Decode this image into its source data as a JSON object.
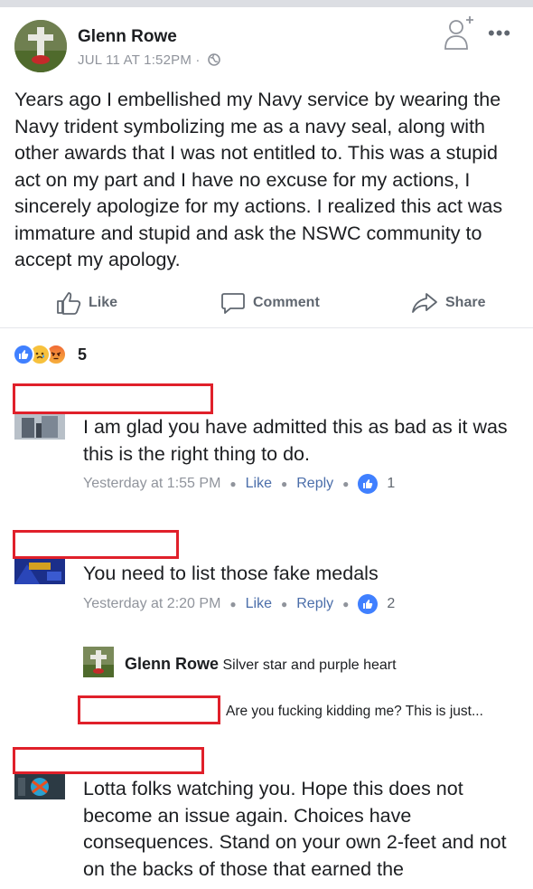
{
  "post": {
    "author": "Glenn Rowe",
    "timestamp": "JUL 11 AT 1:52PM ·",
    "privacy_icon": "globe-icon",
    "text": "Years ago I embellished my Navy service by wearing the Navy trident symbolizing me as a navy seal, along with other awards that I was not entitled to. This was a stupid act on my part and I have no excuse for my actions, I sincerely apologize for my actions. I realized this act was immature and stupid and ask the NSWC community to accept my apology."
  },
  "actions": {
    "like": "Like",
    "comment": "Comment",
    "share": "Share"
  },
  "reactions": {
    "count": "5",
    "types": [
      "like",
      "sad",
      "angry"
    ]
  },
  "comments": [
    {
      "text": "I am glad you have admitted this as bad as it was this is the right thing to do.",
      "time": "Yesterday at 1:55 PM",
      "like": "Like",
      "reply": "Reply",
      "likes": "1"
    },
    {
      "text": "You need to list those fake medals",
      "time": "Yesterday at 2:20 PM",
      "like": "Like",
      "reply": "Reply",
      "likes": "2"
    },
    {
      "text": "Lotta folks watching you.  Hope this does not become an issue again.  Choices have consequences.  Stand on your own 2-feet and not on the backs of those that earned the"
    }
  ],
  "replies": [
    {
      "author": "Glenn Rowe",
      "text": "Silver star and purple heart"
    },
    {
      "text": "Are you fucking kidding me?  This is just..."
    }
  ],
  "colors": {
    "redaction": "#e0202a",
    "link": "#4b6eaa",
    "like_blue": "#4080ff"
  }
}
